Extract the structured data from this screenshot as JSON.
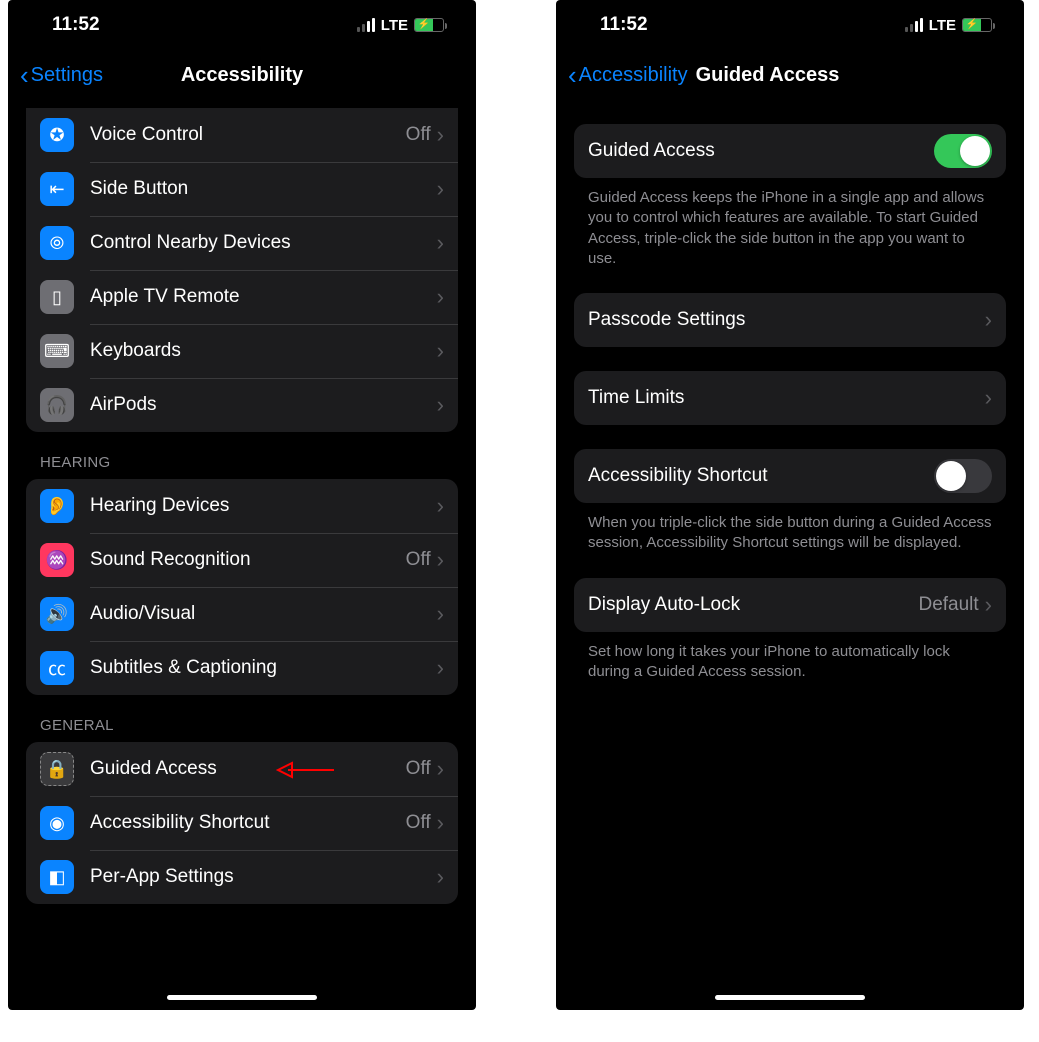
{
  "status": {
    "time": "11:52",
    "network": "LTE"
  },
  "left": {
    "back": "Settings",
    "title": "Accessibility",
    "groupA": [
      {
        "icon": "voice-control-icon",
        "bg": "#0a84ff",
        "label": "Voice Control",
        "value": "Off"
      },
      {
        "icon": "side-button-icon",
        "bg": "#0a84ff",
        "label": "Side Button",
        "value": ""
      },
      {
        "icon": "nearby-devices-icon",
        "bg": "#0a84ff",
        "label": "Control Nearby Devices",
        "value": ""
      },
      {
        "icon": "apple-tv-remote-icon",
        "bg": "#6e6e73",
        "label": "Apple TV Remote",
        "value": ""
      },
      {
        "icon": "keyboards-icon",
        "bg": "#6e6e73",
        "label": "Keyboards",
        "value": ""
      },
      {
        "icon": "airpods-icon",
        "bg": "#6e6e73",
        "label": "AirPods",
        "value": ""
      }
    ],
    "hearing_header": "HEARING",
    "hearing": [
      {
        "icon": "hearing-devices-icon",
        "bg": "#0a84ff",
        "label": "Hearing Devices",
        "value": ""
      },
      {
        "icon": "sound-recognition-icon",
        "bg": "#ff375f",
        "label": "Sound Recognition",
        "value": "Off"
      },
      {
        "icon": "audio-visual-icon",
        "bg": "#0a84ff",
        "label": "Audio/Visual",
        "value": ""
      },
      {
        "icon": "subtitles-icon",
        "bg": "#0a84ff",
        "label": "Subtitles & Captioning",
        "value": ""
      }
    ],
    "general_header": "GENERAL",
    "general": [
      {
        "icon": "guided-access-icon",
        "bg": "#3a3a3c",
        "label": "Guided Access",
        "value": "Off"
      },
      {
        "icon": "accessibility-shortcut-icon",
        "bg": "#0a84ff",
        "label": "Accessibility Shortcut",
        "value": "Off"
      },
      {
        "icon": "per-app-settings-icon",
        "bg": "#0a84ff",
        "label": "Per-App Settings",
        "value": ""
      }
    ]
  },
  "right": {
    "back": "Accessibility",
    "title": "Guided Access",
    "toggle1_label": "Guided Access",
    "toggle1_on": true,
    "desc1": "Guided Access keeps the iPhone in a single app and allows you to control which features are available. To start Guided Access, triple-click the side button in the app you want to use.",
    "passcode_label": "Passcode Settings",
    "timelimits_label": "Time Limits",
    "shortcut_label": "Accessibility Shortcut",
    "shortcut_on": false,
    "desc2": "When you triple-click the side button during a Guided Access session, Accessibility Shortcut settings will be displayed.",
    "autolock_label": "Display Auto-Lock",
    "autolock_value": "Default",
    "desc3": "Set how long it takes your iPhone to automatically lock during a Guided Access session."
  }
}
